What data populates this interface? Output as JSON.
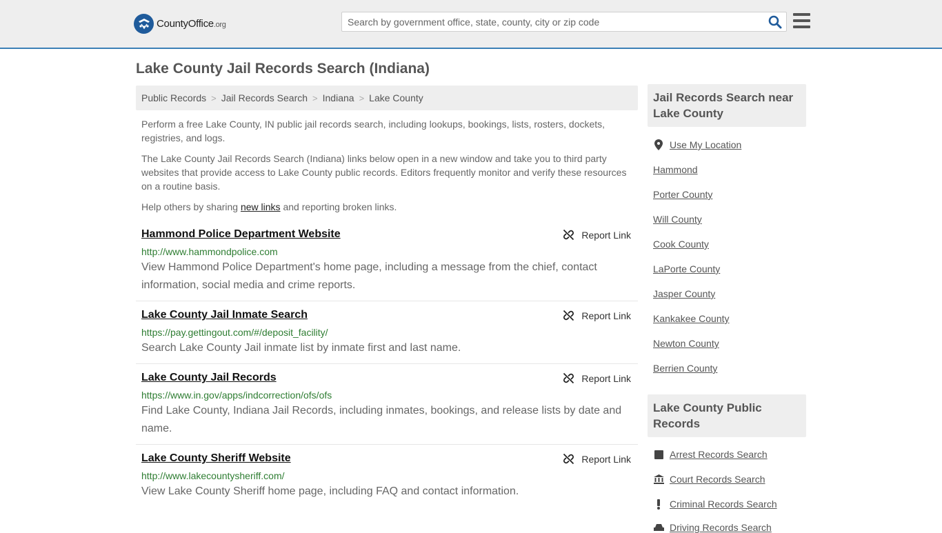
{
  "header": {
    "logo_name": "CountyOffice",
    "logo_tld": ".org",
    "search_placeholder": "Search by government office, state, county, city or zip code"
  },
  "page_title": "Lake County Jail Records Search (Indiana)",
  "breadcrumb": [
    "Public Records",
    "Jail Records Search",
    "Indiana",
    "Lake County"
  ],
  "intro": {
    "p1": "Perform a free Lake County, IN public jail records search, including lookups, bookings, lists, rosters, dockets, registries, and logs.",
    "p2": "The Lake County Jail Records Search (Indiana) links below open in a new window and take you to third party websites that provide access to Lake County public records. Editors frequently monitor and verify these resources on a routine basis.",
    "p3_before": "Help others by sharing ",
    "p3_link": "new links",
    "p3_after": " and reporting broken links."
  },
  "report_label": "Report Link",
  "listings": [
    {
      "title": "Hammond Police Department Website",
      "url": "http://www.hammondpolice.com",
      "desc": "View Hammond Police Department's home page, including a message from the chief, contact information, social media and crime reports."
    },
    {
      "title": "Lake County Jail Inmate Search",
      "url": "https://pay.gettingout.com/#/deposit_facility/",
      "desc": "Search Lake County Jail inmate list by inmate first and last name."
    },
    {
      "title": "Lake County Jail Records",
      "url": "https://www.in.gov/apps/indcorrection/ofs/ofs",
      "desc": "Find Lake County, Indiana Jail Records, including inmates, bookings, and release lists by date and name."
    },
    {
      "title": "Lake County Sheriff Website",
      "url": "http://www.lakecountysheriff.com/",
      "desc": "View Lake County Sheriff home page, including FAQ and contact information."
    }
  ],
  "sidebar": {
    "nearby_heading": "Jail Records Search near Lake County",
    "use_location": "Use My Location",
    "nearby": [
      "Hammond",
      "Porter County",
      "Will County",
      "Cook County",
      "LaPorte County",
      "Jasper County",
      "Kankakee County",
      "Newton County",
      "Berrien County"
    ],
    "public_heading": "Lake County Public Records",
    "public_links": [
      {
        "label": "Arrest Records Search",
        "icon": "square-icon"
      },
      {
        "label": "Court Records Search",
        "icon": "courthouse-icon"
      },
      {
        "label": "Criminal Records Search",
        "icon": "exclamation-icon"
      },
      {
        "label": "Driving Records Search",
        "icon": "car-icon"
      }
    ]
  }
}
